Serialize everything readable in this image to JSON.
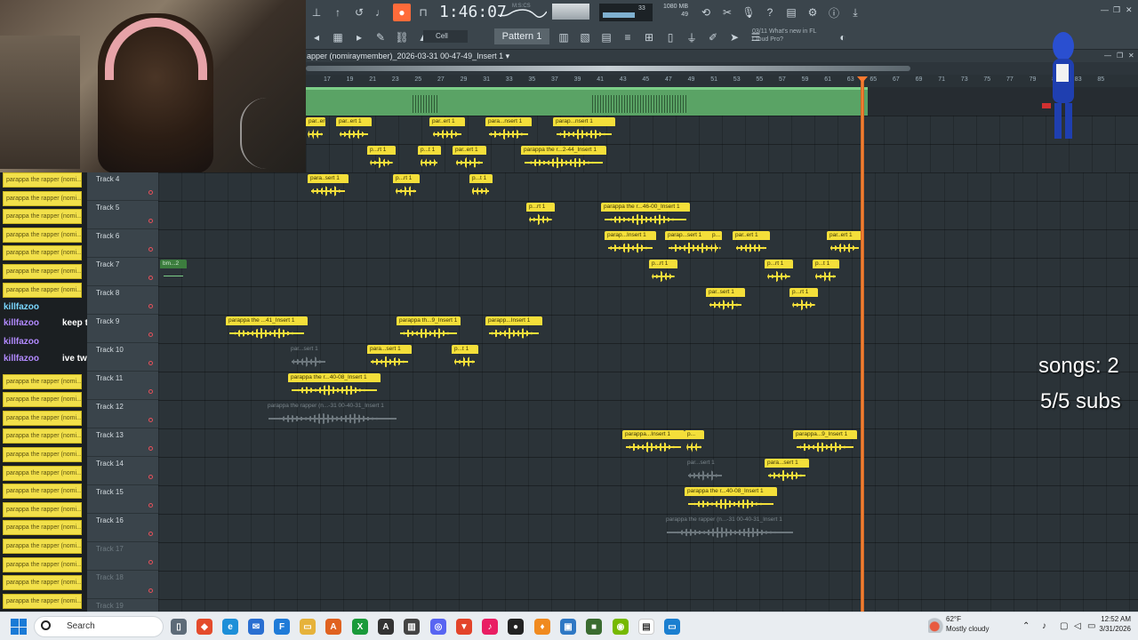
{
  "toolbar": {
    "time": "1:46:07",
    "time_unit": "M:S:CS",
    "cpu_value": "33",
    "voices": "49",
    "mem": "1080 MB",
    "mem2": "49",
    "snap": "Cell",
    "pattern": "Pattern 1",
    "news_date": "03/11",
    "news_title": "What's new in FL",
    "news_sub": "Cloud Pro?"
  },
  "playlist": {
    "title": "apper (nomiraymember)_2026-03-31 00-47-49_Insert 1",
    "ruler": [
      "17",
      "19",
      "21",
      "23",
      "25",
      "27",
      "29",
      "31",
      "33",
      "35",
      "37",
      "39",
      "41",
      "43",
      "45",
      "47",
      "49",
      "51",
      "53",
      "55",
      "57",
      "59",
      "61",
      "63",
      "65",
      "67",
      "69",
      "71",
      "73",
      "75",
      "77",
      "79",
      "81",
      "83",
      "85"
    ]
  },
  "tracks": [
    {
      "name": "Track 4",
      "dim": false
    },
    {
      "name": "Track 5",
      "dim": false
    },
    {
      "name": "Track 6",
      "dim": false
    },
    {
      "name": "Track 7",
      "dim": false
    },
    {
      "name": "Track 8",
      "dim": false
    },
    {
      "name": "Track 9",
      "dim": false
    },
    {
      "name": "Track 10",
      "dim": false
    },
    {
      "name": "Track 11",
      "dim": false
    },
    {
      "name": "Track 12",
      "dim": false
    },
    {
      "name": "Track 13",
      "dim": false
    },
    {
      "name": "Track 14",
      "dim": false
    },
    {
      "name": "Track 15",
      "dim": false
    },
    {
      "name": "Track 16",
      "dim": false
    },
    {
      "name": "Track 17",
      "dim": true
    },
    {
      "name": "Track 18",
      "dim": true
    },
    {
      "name": "Track 19",
      "dim": true
    }
  ],
  "clips": {
    "c01": "par..ert 1",
    "c02": "par..ert 1",
    "c03": "par..ert 1",
    "c04": "para...nsert 1",
    "c05": "parap...nsert 1",
    "c06": "p...rt 1",
    "c07": "p...t 1",
    "c08": "par..ert 1",
    "c09": "parappa the r...2-44_Insert 1",
    "c10": "para..sert 1",
    "c11": "p...rt 1",
    "c12": "p...t 1",
    "c13": "p...rt 1",
    "c14": "parappa the r...46-00_Insert 1",
    "c15": "parap...Insert 1",
    "c16": "parap...sert 1",
    "c17": "p...",
    "c18": "par..ert 1",
    "c19": "par..ert 1",
    "c20": "bm...2",
    "c21": "p...rt 1",
    "c22": "p...rt 1",
    "c23": "p...t 1",
    "c24": "par..sert 1",
    "c25": "p...rt 1",
    "c26": "parappa the ...41_Insert 1",
    "c27": "parappa th...9_Insert 1",
    "c28": "parapp...Insert 1",
    "c29": "par...sert 1",
    "c30": "para...sert 1",
    "c31": "p...t 1",
    "c32": "parappa the r...40-08_Insert 1",
    "c33": "parappa the rapper (n...-31 00-40-31_Insert 1",
    "c34": "parappa...Insert 1",
    "c35": "p...",
    "c36": "parappa...9_Insert 1",
    "c37": "par...sert 1",
    "c38": "para...sert 1",
    "c39": "parappa the r...40-08_Insert 1",
    "c40": "parappa the rapper (n...-31 00-40-31_Insert 1"
  },
  "chat": {
    "item": "parappa the rapper (nomi...",
    "user": "killfazoo",
    "msg1": "keep those",
    "msg2": "ive twin"
  },
  "overlay": {
    "songs": "songs: 2",
    "subs": "5/5 subs"
  },
  "taskbar": {
    "search": "Search",
    "temp": "62°F",
    "weather": "Mostly cloudy",
    "time": "12:52 AM",
    "date": "3/31/2026"
  },
  "colors": {
    "clip": "#f4df3a",
    "playhead": "#ff7a30",
    "master_clip": "#5aa365"
  }
}
